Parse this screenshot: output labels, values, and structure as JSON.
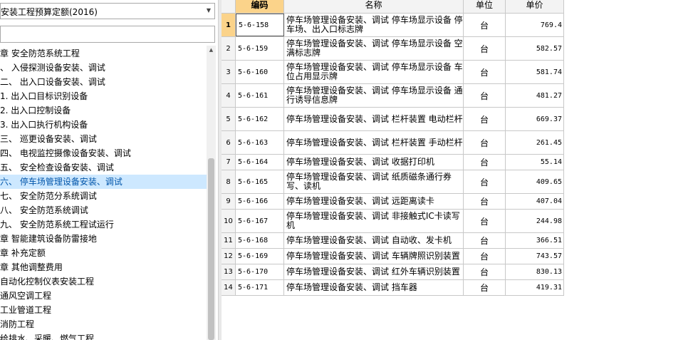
{
  "quota_select": {
    "value": "安装工程预算定额(2016)",
    "arrow": "▼"
  },
  "search": {
    "value": "",
    "placeholder": ""
  },
  "tree": [
    {
      "label": "章 安全防范系统工程",
      "selected": false
    },
    {
      "label": "、 入侵探测设备安装、调试",
      "selected": false
    },
    {
      "label": "二、 出入口设备安装、调试",
      "selected": false
    },
    {
      "label": "1. 出入口目标识别设备",
      "selected": false
    },
    {
      "label": "2. 出入口控制设备",
      "selected": false
    },
    {
      "label": "3. 出入口执行机构设备",
      "selected": false
    },
    {
      "label": "三、 巡更设备安装、调试",
      "selected": false
    },
    {
      "label": "四、 电视监控摄像设备安装、调试",
      "selected": false
    },
    {
      "label": "五、 安全检查设备安装、调试",
      "selected": false
    },
    {
      "label": "六、 停车场管理设备安装、调试",
      "selected": true
    },
    {
      "label": "七、 安全防范分系统调试",
      "selected": false
    },
    {
      "label": "八、 安全防范系统调试",
      "selected": false
    },
    {
      "label": "九、 安全防范系统工程试运行",
      "selected": false
    },
    {
      "label": "章 智能建筑设备防雷接地",
      "selected": false
    },
    {
      "label": "章 补充定额",
      "selected": false
    },
    {
      "label": "章 其他调整费用",
      "selected": false
    },
    {
      "label": "自动化控制仪表安装工程",
      "selected": false
    },
    {
      "label": "通风空调工程",
      "selected": false
    },
    {
      "label": "工业管道工程",
      "selected": false
    },
    {
      "label": "消防工程",
      "selected": false
    },
    {
      "label": "给排水、采暖、燃气工程",
      "selected": false
    }
  ],
  "grid": {
    "headers": {
      "code": "编码",
      "name": "名称",
      "unit": "单位",
      "price": "单价"
    },
    "rows": [
      {
        "idx": "1",
        "code": "5-6-158",
        "name": "停车场管理设备安装、调试 停车场显示设备 停车场、出入口标志牌",
        "unit": "台",
        "price": "769.4"
      },
      {
        "idx": "2",
        "code": "5-6-159",
        "name": "停车场管理设备安装、调试 停车场显示设备 空满标志牌",
        "unit": "台",
        "price": "582.57"
      },
      {
        "idx": "3",
        "code": "5-6-160",
        "name": "停车场管理设备安装、调试 停车场显示设备 车位占用显示牌",
        "unit": "台",
        "price": "581.74"
      },
      {
        "idx": "4",
        "code": "5-6-161",
        "name": "停车场管理设备安装、调试 停车场显示设备 通行诱导信息牌",
        "unit": "台",
        "price": "481.27"
      },
      {
        "idx": "5",
        "code": "5-6-162",
        "name": "停车场管理设备安装、调试 栏杆装置 电动栏杆",
        "unit": "台",
        "price": "669.37"
      },
      {
        "idx": "6",
        "code": "5-6-163",
        "name": "停车场管理设备安装、调试 栏杆装置 手动栏杆",
        "unit": "台",
        "price": "261.45"
      },
      {
        "idx": "7",
        "code": "5-6-164",
        "name": "停车场管理设备安装、调试 收据打印机",
        "unit": "台",
        "price": "55.14"
      },
      {
        "idx": "8",
        "code": "5-6-165",
        "name": "停车场管理设备安装、调试 纸质磁条通行券写、读机",
        "unit": "台",
        "price": "409.65"
      },
      {
        "idx": "9",
        "code": "5-6-166",
        "name": "停车场管理设备安装、调试 远距离读卡",
        "unit": "台",
        "price": "407.04"
      },
      {
        "idx": "10",
        "code": "5-6-167",
        "name": "停车场管理设备安装、调试 非接触式IC卡读写机",
        "unit": "台",
        "price": "244.98"
      },
      {
        "idx": "11",
        "code": "5-6-168",
        "name": "停车场管理设备安装、调试 自动收、发卡机",
        "unit": "台",
        "price": "366.51"
      },
      {
        "idx": "12",
        "code": "5-6-169",
        "name": "停车场管理设备安装、调试 车辆牌照识别装置",
        "unit": "台",
        "price": "743.57"
      },
      {
        "idx": "13",
        "code": "5-6-170",
        "name": "停车场管理设备安装、调试 红外车辆识别装置",
        "unit": "台",
        "price": "830.13"
      },
      {
        "idx": "14",
        "code": "5-6-171",
        "name": "停车场管理设备安装、调试 挡车器",
        "unit": "台",
        "price": "419.31"
      }
    ]
  },
  "colors": {
    "header_active": "#fbd38a",
    "selected_tree_bg": "#cde8ff",
    "selected_tree_text": "#0055aa"
  }
}
